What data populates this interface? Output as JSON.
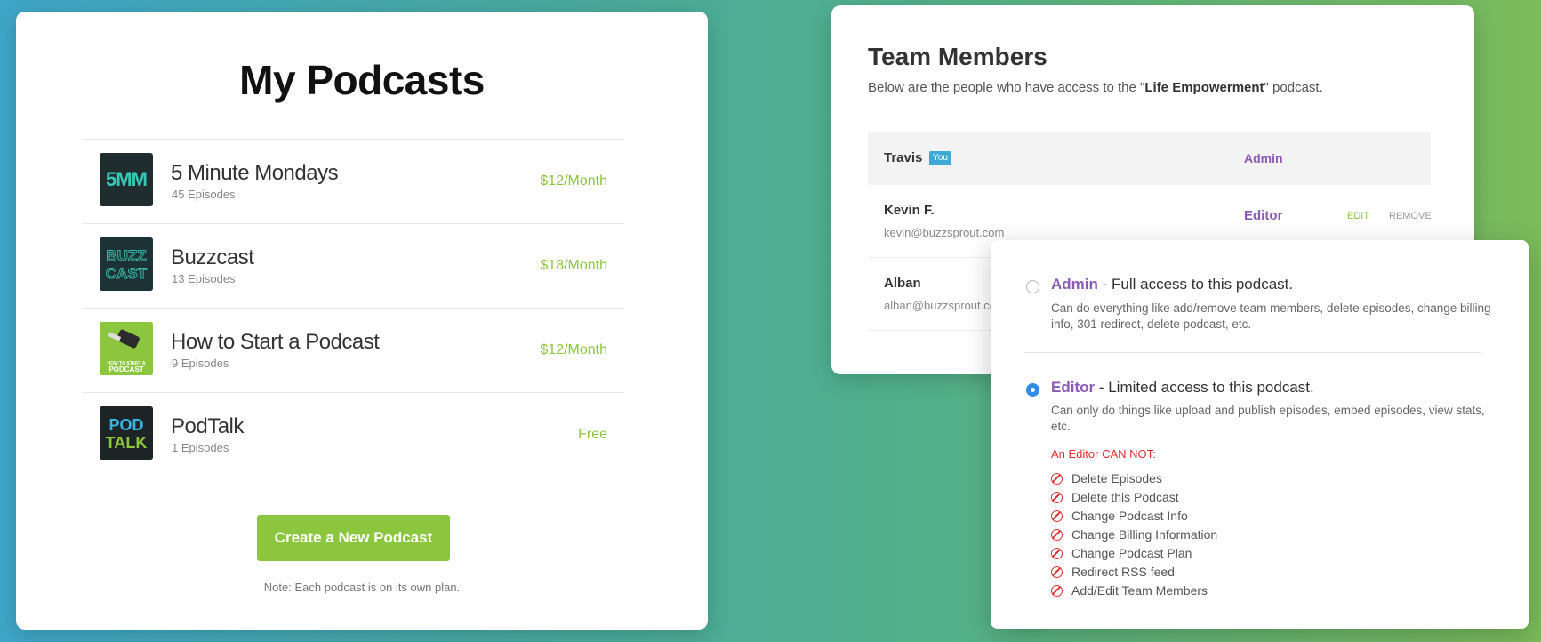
{
  "podcasts": {
    "title": "My Podcasts",
    "items": [
      {
        "name": "5 Minute Mondays",
        "episodes": "45 Episodes",
        "price": "$12/Month",
        "art": "5MM"
      },
      {
        "name": "Buzzcast",
        "episodes": "13 Episodes",
        "price": "$18/Month",
        "art": "BUZZ CAST"
      },
      {
        "name": "How to Start a Podcast",
        "episodes": "9 Episodes",
        "price": "$12/Month",
        "art": "HOW TO START A PODCAST"
      },
      {
        "name": "PodTalk",
        "episodes": "1 Episodes",
        "price": "Free",
        "art": "POD TALK"
      }
    ],
    "create_label": "Create a New Podcast",
    "note": "Note: Each podcast is on its own plan."
  },
  "team": {
    "title": "Team Members",
    "desc_prefix": "Below are the people who have access to the \"",
    "podcast_name": "Life Empowerment",
    "desc_suffix": "\" podcast.",
    "members": [
      {
        "name": "Travis",
        "badge": "You",
        "email": "",
        "role": "Admin"
      },
      {
        "name": "Kevin F.",
        "badge": "",
        "email": "kevin@buzzsprout.com",
        "role": "Editor",
        "edit": "EDIT",
        "remove": "REMOVE"
      },
      {
        "name": "Alban",
        "badge": "",
        "email": "alban@buzzsprout.com",
        "role": "",
        "edit": "",
        "remove": ""
      }
    ]
  },
  "roles": {
    "admin": {
      "name": "Admin",
      "summary": " - Full access to this podcast.",
      "desc": "Can do everything like add/remove team members, delete episodes, change billing info, 301 redirect, delete podcast, etc.",
      "selected": false
    },
    "editor": {
      "name": "Editor",
      "summary": " - Limited access to this podcast.",
      "desc": "Can only do things like upload and publish episodes, embed episodes, view stats, etc.",
      "selected": true
    },
    "cannot_title": "An Editor CAN NOT:",
    "cannot": [
      "Delete Episodes",
      "Delete this Podcast",
      "Change Podcast Info",
      "Change Billing Information",
      "Change Podcast Plan",
      "Redirect RSS feed",
      "Add/Edit Team Members"
    ]
  }
}
